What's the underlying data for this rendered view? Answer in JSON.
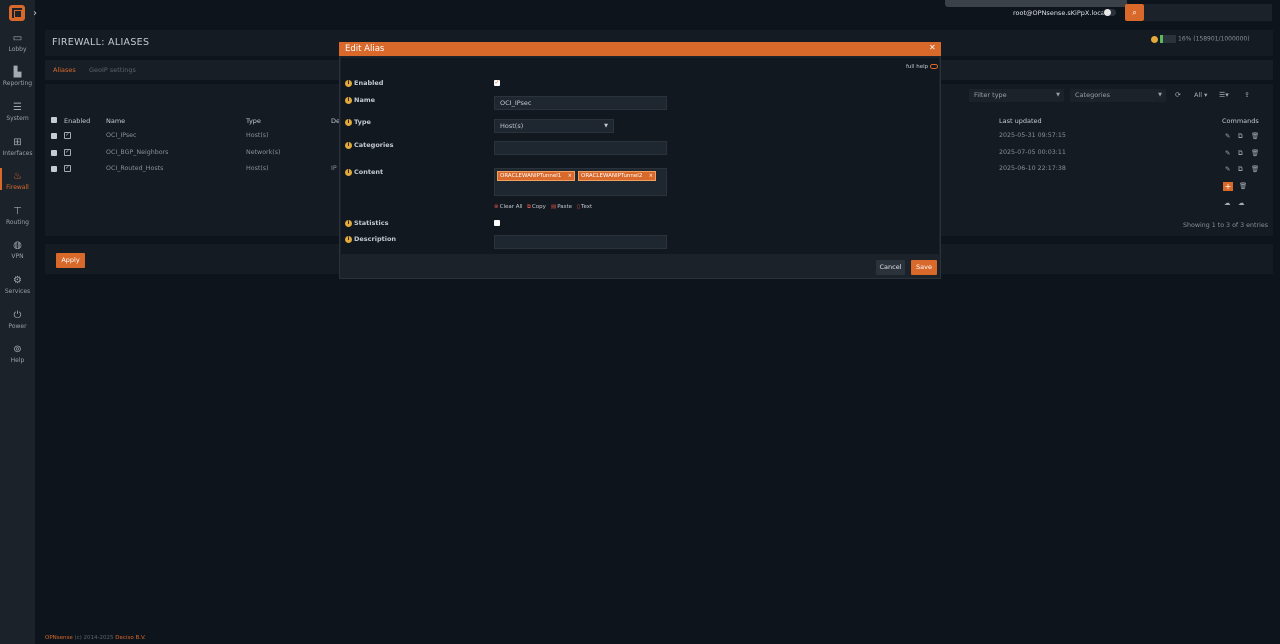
{
  "sidebar": {
    "items": [
      {
        "label": "Lobby",
        "icon": "laptop-icon"
      },
      {
        "label": "Reporting",
        "icon": "chart-icon"
      },
      {
        "label": "System",
        "icon": "server-icon"
      },
      {
        "label": "Interfaces",
        "icon": "network-icon"
      },
      {
        "label": "Firewall",
        "icon": "fire-icon"
      },
      {
        "label": "Routing",
        "icon": "signpost-icon"
      },
      {
        "label": "VPN",
        "icon": "globe-icon"
      },
      {
        "label": "Services",
        "icon": "gear-icon"
      },
      {
        "label": "Power",
        "icon": "plug-icon"
      },
      {
        "label": "Help",
        "icon": "lifebuoy-icon"
      }
    ]
  },
  "header": {
    "user": "root@OPNsense.sKiPpX.local"
  },
  "page": {
    "title": "FIREWALL: ALIASES",
    "state_text": "16% (158901/1000000)",
    "state_percent": 16,
    "tabs": [
      "Aliases",
      "GeoIP settings"
    ]
  },
  "filters": {
    "filter_type": "Filter type",
    "categories": "Categories",
    "rows_all": "All"
  },
  "table": {
    "headers": {
      "enabled": "Enabled",
      "name": "Name",
      "type": "Type",
      "description": "De",
      "last_updated": "Last updated",
      "commands": "Commands"
    },
    "rows": [
      {
        "name": "OCI_IPsec",
        "type": "Host(s)",
        "desc": "",
        "last_updated": "2025-05-31 09:57:15"
      },
      {
        "name": "OCI_BGP_Neighbors",
        "type": "Network(s)",
        "desc": "",
        "last_updated": "2025-07-05 00:03:11"
      },
      {
        "name": "OCI_Routed_Hosts",
        "type": "Host(s)",
        "desc": "IP",
        "last_updated": "2025-06-10 22:17:38"
      }
    ],
    "status": "Showing 1 to 3 of 3 entries"
  },
  "apply_label": "Apply",
  "footer": {
    "product": "OPNsense",
    "copyright": " (c) 2014-2025 ",
    "company": "Deciso B.V."
  },
  "modal": {
    "title": "Edit Alias",
    "full_help": "full help",
    "labels": {
      "enabled": "Enabled",
      "name": "Name",
      "type": "Type",
      "categories": "Categories",
      "content": "Content",
      "statistics": "Statistics",
      "description": "Description"
    },
    "values": {
      "name": "OCI_IPsec",
      "type": "Host(s)",
      "categories": "",
      "description": ""
    },
    "content_tags": [
      "ORACLEWANIPTunnel1",
      "ORACLEWANIPTunnel2"
    ],
    "tag_actions": [
      "Clear All",
      "Copy",
      "Paste",
      "Text"
    ],
    "cancel": "Cancel",
    "save": "Save"
  }
}
